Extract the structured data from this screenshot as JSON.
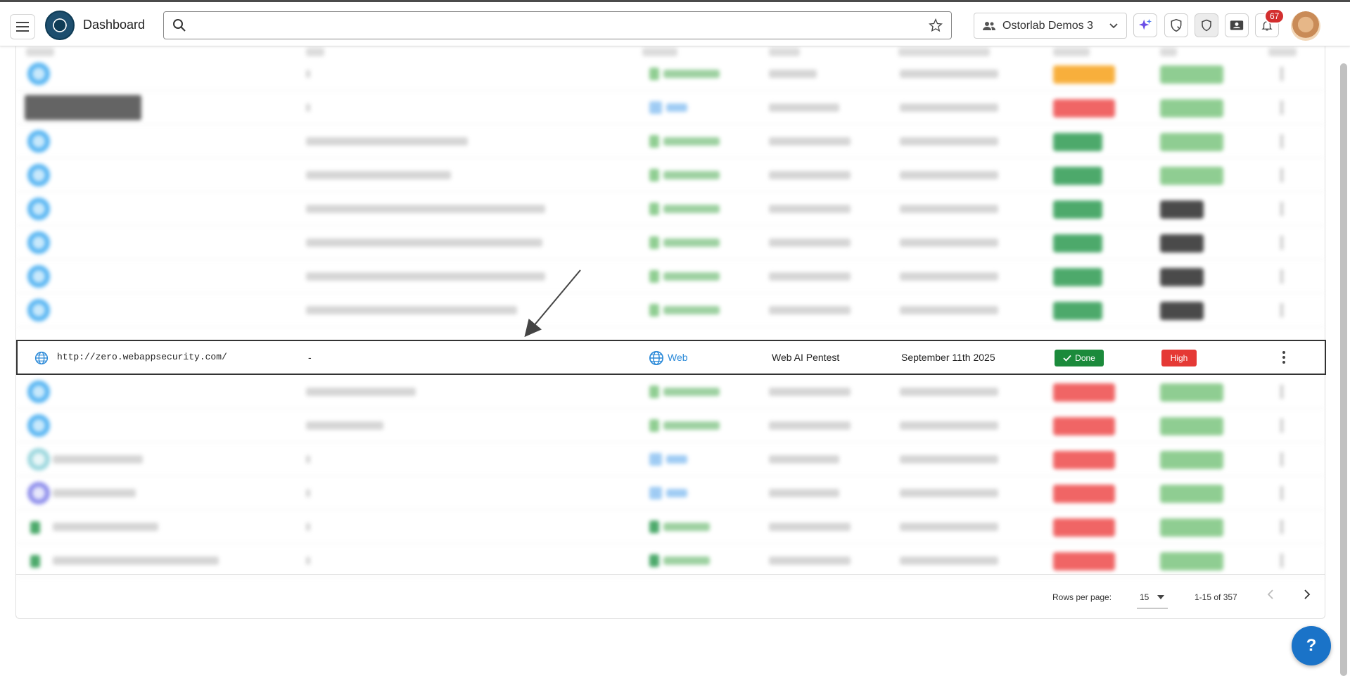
{
  "header": {
    "title": "Dashboard",
    "search_placeholder": "",
    "org_name": "Ostorlab Demos 3",
    "notification_count": "67"
  },
  "highlighted_row": {
    "target": "http://zero.webappsecurity.com/",
    "title": "-",
    "asset_type": "Web",
    "plan": "Web AI Pentest",
    "created": "September 11th 2025",
    "progress": "Done",
    "risk": "High"
  },
  "colors": {
    "done": "#1b8a3b",
    "risk_high": "#e53935",
    "web_link": "#2a89d8",
    "help_button": "#1a73c8"
  },
  "icons": [
    "menu-icon",
    "search-icon",
    "star-icon",
    "team-icon",
    "chevron-down-icon",
    "sparkle-icon",
    "shield-check-icon",
    "shield-icon",
    "contact-card-icon",
    "bell-icon",
    "globe-icon",
    "check-icon",
    "more-vert-icon",
    "chevron-left-icon",
    "chevron-right-icon"
  ],
  "pagination": {
    "rows_per_page_label": "Rows per page:",
    "rows_per_page": "15",
    "range": "1-15 of 357"
  },
  "help_label": "?"
}
